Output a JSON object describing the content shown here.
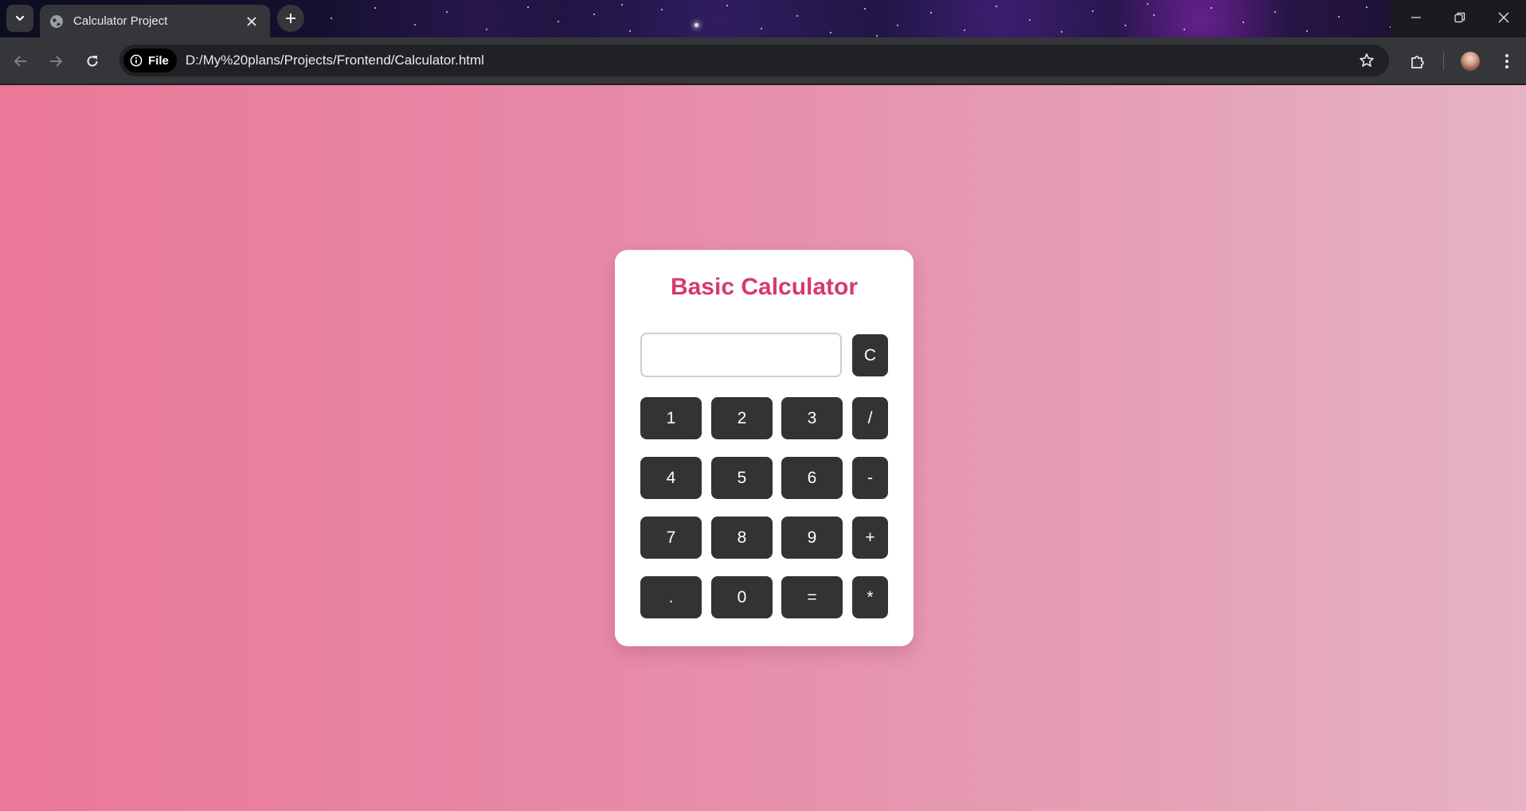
{
  "browser": {
    "tab_title": "Calculator Project",
    "chip_label": "File",
    "url": "D:/My%20plans/Projects/Frontend/Calculator.html"
  },
  "calculator": {
    "title": "Basic Calculator",
    "display_value": "",
    "clear_label": "C",
    "rows": [
      [
        "1",
        "2",
        "3",
        "/"
      ],
      [
        "4",
        "5",
        "6",
        "-"
      ],
      [
        "7",
        "8",
        "9",
        "+"
      ],
      [
        ".",
        "0",
        "=",
        "*"
      ]
    ]
  },
  "colors": {
    "title_accent": "#d63a6a",
    "button_bg": "#333333",
    "page_gradient_start": "#ea7898",
    "page_gradient_end": "#e6b3c4"
  },
  "icons": [
    "tab-search-icon",
    "globe-icon",
    "close-icon",
    "plus-icon",
    "minimize-icon",
    "restore-icon",
    "back-arrow-icon",
    "forward-arrow-icon",
    "reload-icon",
    "info-icon",
    "star-icon",
    "extensions-icon",
    "avatar",
    "kebab-menu-icon"
  ]
}
